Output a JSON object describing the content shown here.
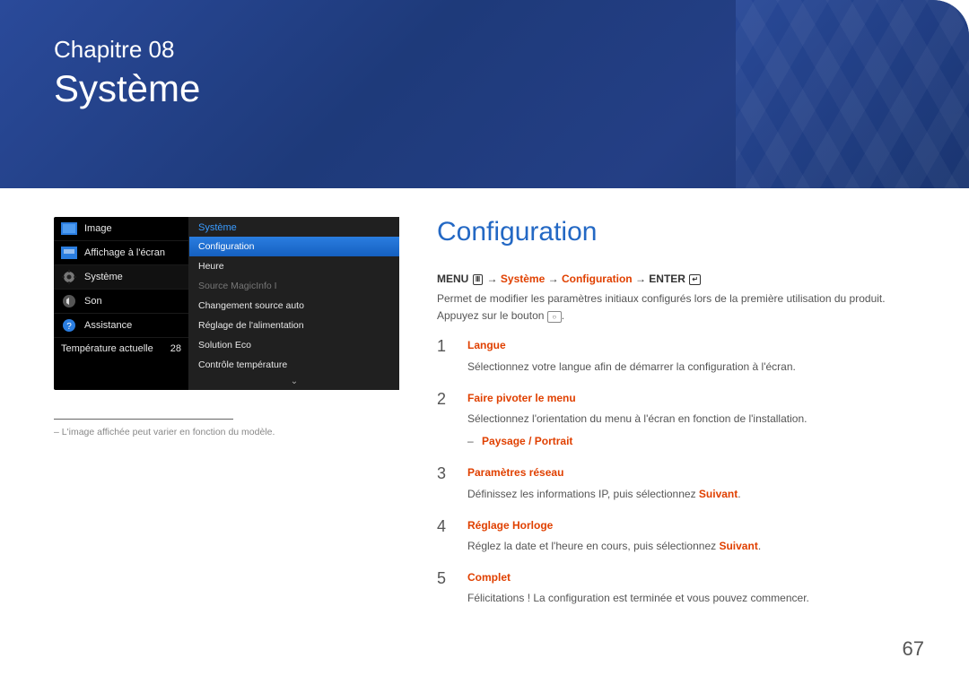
{
  "header": {
    "chapter_label": "Chapitre 08",
    "chapter_title": "Système"
  },
  "tv_menu": {
    "left_items": [
      {
        "icon": "image-icon",
        "label": "Image"
      },
      {
        "icon": "display-icon",
        "label": "Affichage à l'écran"
      },
      {
        "icon": "gear-icon",
        "label": "Système",
        "active": true
      },
      {
        "icon": "speaker-icon",
        "label": "Son"
      },
      {
        "icon": "help-icon",
        "label": "Assistance"
      }
    ],
    "left_status_label": "Température actuelle",
    "left_status_value": "28",
    "right_header": "Système",
    "right_options": [
      {
        "label": "Configuration",
        "state": "selected"
      },
      {
        "label": "Heure"
      },
      {
        "label": "Source MagicInfo I",
        "state": "disabled"
      },
      {
        "label": "Changement source auto"
      },
      {
        "label": "Réglage de l'alimentation"
      },
      {
        "label": "Solution Eco"
      },
      {
        "label": "Contrôle température"
      }
    ],
    "scroll_indicator": "⌄"
  },
  "caption_text": "L'image affichée peut varier en fonction du modèle.",
  "doc": {
    "title": "Configuration",
    "breadcrumb_menu": "MENU",
    "breadcrumb_path1": "Système",
    "breadcrumb_path2": "Configuration",
    "breadcrumb_enter": "ENTER",
    "breadcrumb_arrow": " → ",
    "intro_line1": "Permet de modifier les paramètres initiaux configurés lors de la première utilisation du produit.",
    "intro_line2_a": "Appuyez sur le bouton ",
    "intro_line2_b": ".",
    "steps": [
      {
        "num": "1",
        "title": "Langue",
        "body": "Sélectionnez votre langue afin de démarrer la configuration à l'écran."
      },
      {
        "num": "2",
        "title": "Faire pivoter le menu",
        "body": "Sélectionnez l'orientation du menu à l'écran en fonction de l'installation.",
        "sub": {
          "dash": "–",
          "label": "Paysage / Portrait"
        }
      },
      {
        "num": "3",
        "title": "Paramètres réseau",
        "body_a": "Définissez les informations IP, puis sélectionnez ",
        "body_em": "Suivant",
        "body_b": "."
      },
      {
        "num": "4",
        "title": "Réglage Horloge",
        "body_a": "Réglez la date et l'heure en cours, puis sélectionnez ",
        "body_em": "Suivant",
        "body_b": "."
      },
      {
        "num": "5",
        "title": "Complet",
        "body": "Félicitations ! La configuration est terminée et vous pouvez commencer."
      }
    ]
  },
  "page_number": "67"
}
